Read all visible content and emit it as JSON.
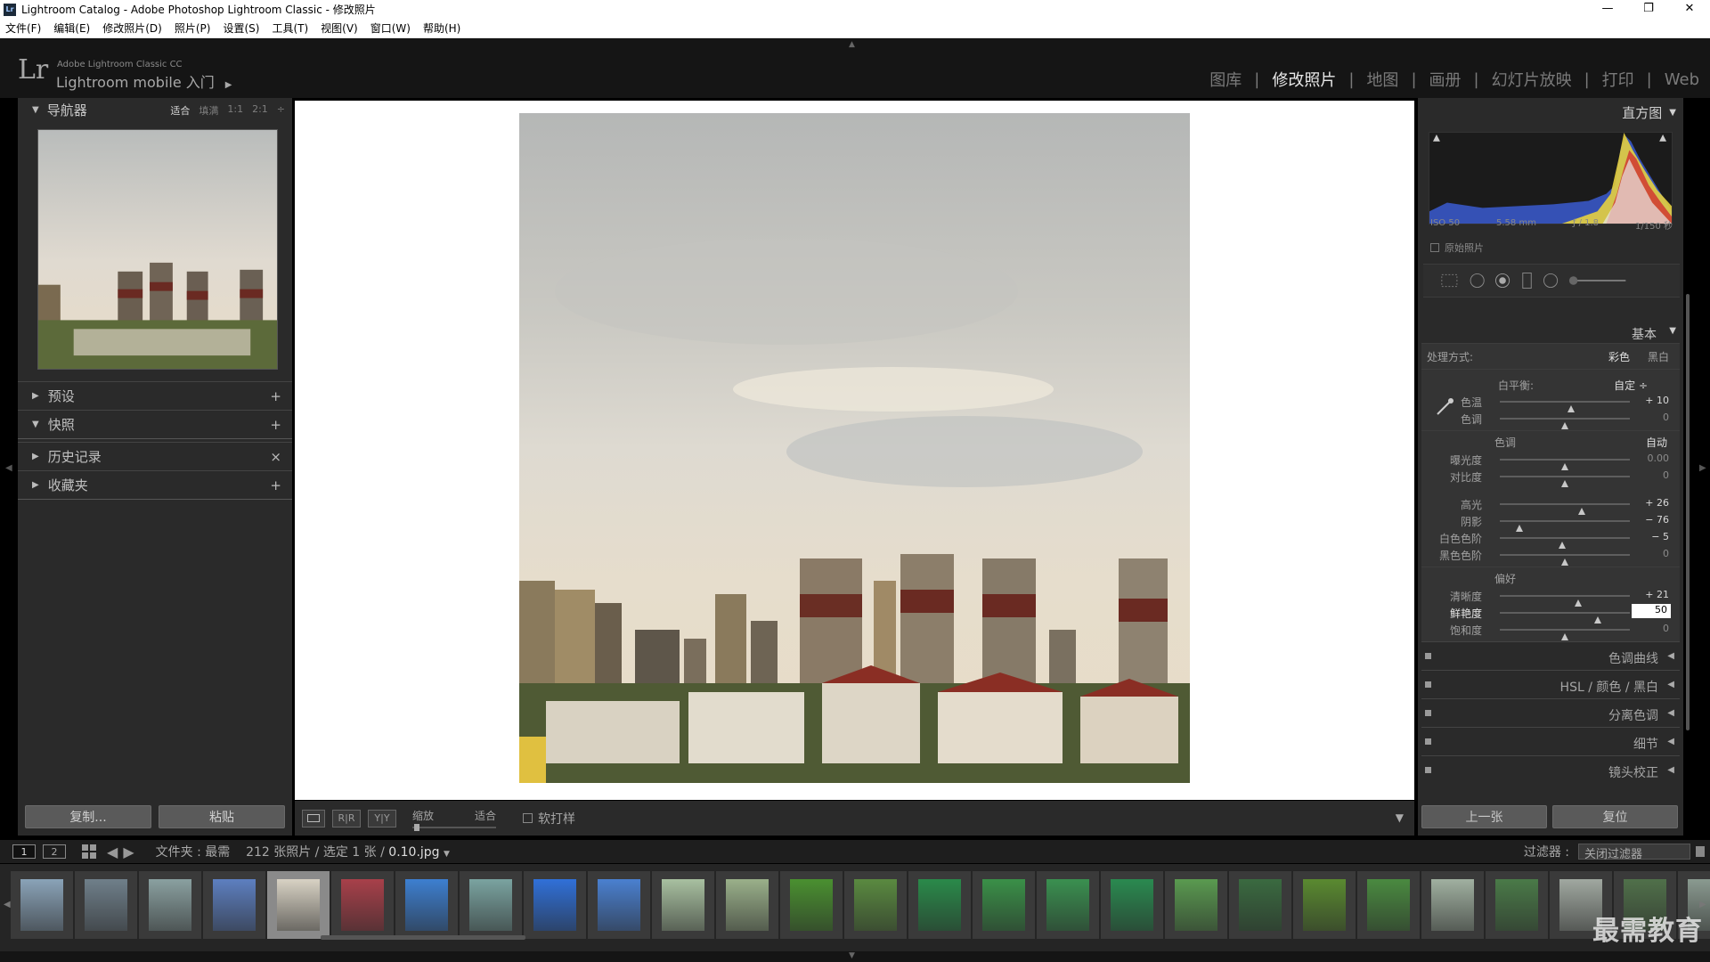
{
  "window": {
    "title": "Lightroom Catalog - Adobe Photoshop Lightroom Classic - 修改照片",
    "app_badge": "Lr",
    "controls": [
      "—",
      "❐",
      "✕"
    ]
  },
  "menu": [
    "文件(F)",
    "编辑(E)",
    "修改照片(D)",
    "照片(P)",
    "设置(S)",
    "工具(T)",
    "视图(V)",
    "窗口(W)",
    "帮助(H)"
  ],
  "identity": {
    "logo": "Lr",
    "product": "Adobe Lightroom Classic CC",
    "mobile": "Lightroom mobile 入门",
    "arrow": "▶"
  },
  "modules": [
    {
      "label": "图库",
      "active": false
    },
    {
      "label": "修改照片",
      "active": true
    },
    {
      "label": "地图",
      "active": false
    },
    {
      "label": "画册",
      "active": false
    },
    {
      "label": "幻灯片放映",
      "active": false
    },
    {
      "label": "打印",
      "active": false
    },
    {
      "label": "Web",
      "active": false
    }
  ],
  "left_panel": {
    "navigator": {
      "title": "导航器",
      "modes": [
        "适合",
        "填满",
        "1:1",
        "2:1"
      ],
      "mode_suffix": "÷"
    },
    "sections": [
      {
        "title": "预设",
        "action": "+",
        "expanded": false
      },
      {
        "title": "快照",
        "action": "+",
        "expanded": true
      },
      {
        "title": "历史记录",
        "action": "×",
        "expanded": false
      },
      {
        "title": "收藏夹",
        "action": "+",
        "expanded": false
      }
    ],
    "copy_label": "复制...",
    "paste_label": "粘贴"
  },
  "toolbar": {
    "zoom_label": "缩放",
    "zoom_value": "适合",
    "softproof_label": "软打样",
    "compare_ry": "R|R",
    "compare_yy": "Y|Y"
  },
  "right_panel": {
    "histogram_title": "直方图",
    "histogram_info": {
      "iso": "ISO 50",
      "focal": "5.58 mm",
      "aperture": "ƒ / 1.8",
      "shutter": "1/150 秒"
    },
    "original_photo": "原始照片",
    "basic": {
      "title": "基本",
      "treatment_label": "处理方式:",
      "treatment_options": [
        "彩色",
        "黑白"
      ],
      "wb_label": "白平衡:",
      "wb_value": "自定 ÷",
      "tone_label": "色调",
      "auto_label": "自动",
      "presence_label": "偏好",
      "sliders_wb": [
        {
          "name": "色温",
          "value": "+ 10",
          "pos": 0.55
        },
        {
          "name": "色调",
          "value": "0",
          "pos": 0.5
        }
      ],
      "sliders_tone": [
        {
          "name": "曝光度",
          "value": "0.00",
          "pos": 0.5
        },
        {
          "name": "对比度",
          "value": "0",
          "pos": 0.5
        }
      ],
      "sliders_tone2": [
        {
          "name": "高光",
          "value": "+ 26",
          "pos": 0.63
        },
        {
          "name": "阴影",
          "value": "− 76",
          "pos": 0.15
        },
        {
          "name": "白色色阶",
          "value": "− 5",
          "pos": 0.48
        },
        {
          "name": "黑色色阶",
          "value": "0",
          "pos": 0.5
        }
      ],
      "sliders_presence": [
        {
          "name": "清晰度",
          "value": "+ 21",
          "pos": 0.6
        },
        {
          "name": "鲜艳度",
          "value": "50",
          "pos": 0.75,
          "editing": true
        },
        {
          "name": "饱和度",
          "value": "0",
          "pos": 0.5
        }
      ]
    },
    "collapsed_sections": [
      "色调曲线",
      "HSL / 颜色 / 黑白",
      "分离色调",
      "细节",
      "镜头校正"
    ],
    "prev_label": "上一张",
    "reset_label": "复位"
  },
  "filmstrip": {
    "page_1": "1",
    "page_2": "2",
    "folder_label": "文件夹 : 最需",
    "count_label": "212 张照片 / 选定 1 张 /",
    "filename": "0.10.jpg",
    "filter_label": "过滤器 :",
    "filter_value": "关闭过滤器",
    "selected_index": 4,
    "thumb_colors": [
      "#8aa3b8",
      "#6f7f8a",
      "#8aa0a0",
      "#5d7fc0",
      "#d8d2c4",
      "#a8404a",
      "#3d7fd0",
      "#7aa3a0",
      "#3070d8",
      "#4a80d0",
      "#a8c0a0",
      "#9ab08a",
      "#4a9030",
      "#5a8a40",
      "#2a8a4a",
      "#3a9048",
      "#3a9050",
      "#2a8a50",
      "#5a9a50",
      "#3a6a40",
      "#5a8a30",
      "#4a8a40",
      "#a0b0a0",
      "#4a7a48",
      "#a0a8a0",
      "#50704a",
      "#8a9a90"
    ]
  },
  "watermark": "最需教育"
}
